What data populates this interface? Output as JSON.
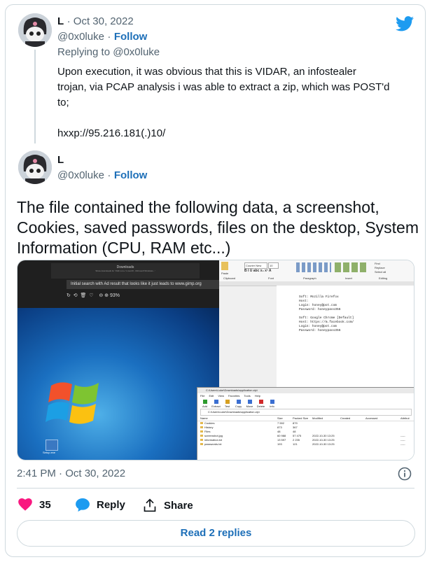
{
  "tweet1": {
    "name": "L",
    "date": "· Oct 30, 2022",
    "handle": "@0x0luke",
    "follow_dot": "·",
    "follow": "Follow",
    "replying": "Replying to @0x0luke",
    "body_line1": "Upon execution, it was obvious that this is VIDAR, an infostealer",
    "body_line2": "trojan, via PCAP analysis i was able to extract a zip, which was POST'd",
    "body_line3": "to;",
    "body_line4": "hxxp://95.216.181(.)10/"
  },
  "tweet2": {
    "name": "L",
    "handle": "@0x0luke",
    "follow_dot": "·",
    "follow": "Follow",
    "body_line1": "The file contained the following data, a screenshot,",
    "body_line2": "Cookies, saved passwords, files on the desktop, System",
    "body_line3": "Information (CPU, RAM etc...)"
  },
  "screenshot": {
    "notif_title": "Downloads",
    "notif_sub": "Show downloads for 'zhkh.Lmu / Lmod.fil - Microsoft Windows...'",
    "notif_text": "Initial search with Ad result that looks like it just leads to www.gimp.org",
    "zoom": "93%",
    "note_soft1": "Soft: Mozilla Firefox",
    "note_host1": "Host:",
    "note_login1": "Login: honey@pot.com",
    "note_pass1": "Password: honeypass356",
    "note_soft2": "Soft: Google Chrome [Default]",
    "note_host2": "Host: https://m.facebook.com/",
    "note_login2": "Login: honey@pot.com",
    "note_pass2": "Password: honeypass356",
    "ribbon_font": "Courier New",
    "ribbon_size": "10",
    "ribbon_group_clipboard": "Clipboard",
    "ribbon_group_font": "Font",
    "ribbon_group_paragraph": "Paragraph",
    "ribbon_group_insert": "Insert",
    "ribbon_group_editing": "Editing",
    "ribbon_find": "Find",
    "ribbon_replace": "Replace",
    "ribbon_select_all": "Select all",
    "ribbon_paste": "Paste",
    "zip_title": "C:\\Users\\Luke\\Downloads\\application.zip\\",
    "zip_menu": [
      "File",
      "Edit",
      "View",
      "Favorites",
      "Tools",
      "Help"
    ],
    "zip_tools": [
      "Add",
      "Extract",
      "Test",
      "Copy",
      "Move",
      "Delete",
      "Info"
    ],
    "zip_path": "C:\\Users\\Luke\\Downloads\\application.zip\\",
    "zip_headers": [
      "Name",
      "Size",
      "Packed Size",
      "Modified",
      "Created",
      "Accessed",
      "Attribut"
    ],
    "zip_rows": [
      [
        "Cookies",
        "7 592",
        "879",
        "",
        "",
        "",
        ""
      ],
      [
        "History",
        "873",
        "367",
        "",
        "",
        "",
        ""
      ],
      [
        "Files",
        "48",
        "48",
        "",
        "",
        "",
        ""
      ],
      [
        "screenshot.jpg",
        "60 988",
        "57 475",
        "2022-10-30 13:25",
        "",
        "",
        "-----"
      ],
      [
        "information.txt",
        "13 597",
        "2 235",
        "2022-10-30 13:25",
        "",
        "",
        "-----"
      ],
      [
        "passwords.txt",
        "193",
        "121",
        "2022-10-30 13:25",
        "",
        "",
        "-----"
      ]
    ],
    "desktop_icon_label": "Setup.exe"
  },
  "footer": {
    "time": "2:41 PM · Oct 30, 2022",
    "likes": "35",
    "reply": "Reply",
    "share": "Share",
    "read_replies": "Read 2 replies"
  },
  "colors": {
    "accent": "#1d6fb8",
    "like": "#f91880",
    "twitter": "#1d9bf0"
  }
}
